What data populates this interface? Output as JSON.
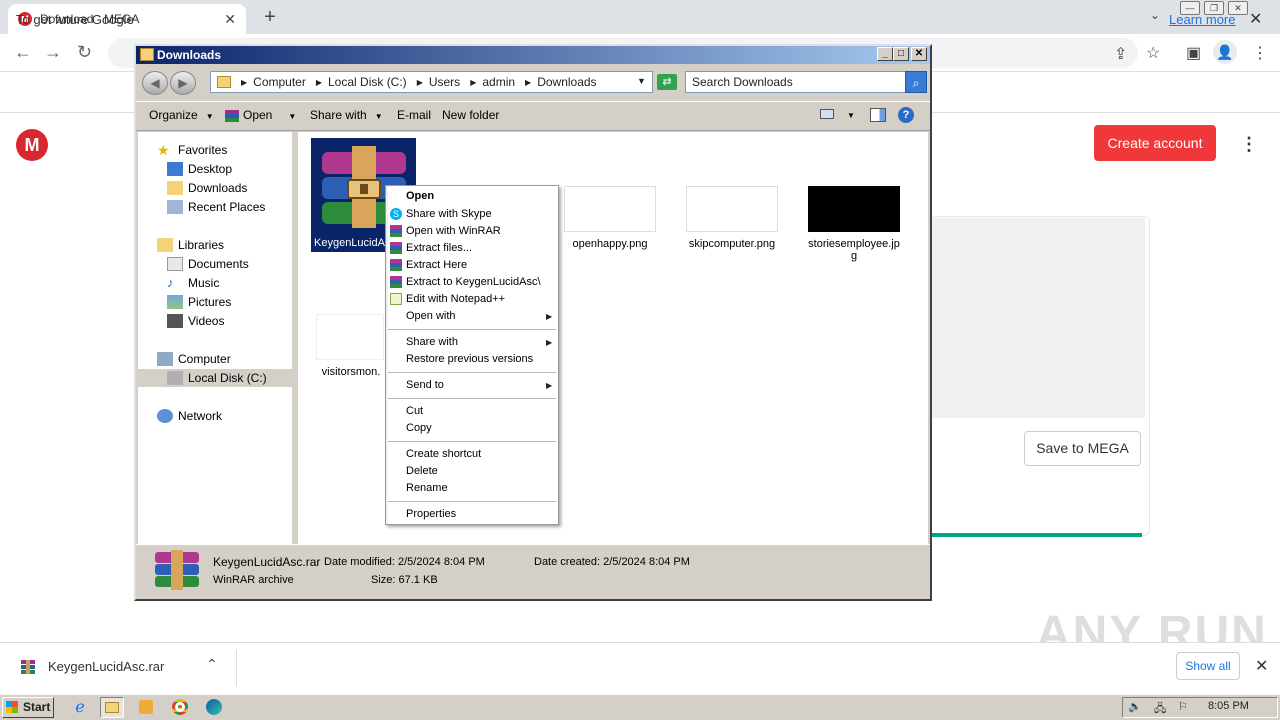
{
  "browser": {
    "tab_title": "Download - MEGA",
    "tab_favicon": "M",
    "new_tab": "+",
    "infobar_text": "To get future Google",
    "infobar_link": "Learn more"
  },
  "mega": {
    "logo": "M",
    "create_account": "Create account",
    "save_to_mega": "Save to MEGA"
  },
  "downloads_bar": {
    "file_name": "KeygenLucidAsc.rar",
    "show_all": "Show all"
  },
  "watermark": "ANY RUN",
  "explorer": {
    "title": "Downloads",
    "breadcrumbs": [
      "Computer",
      "Local Disk (C:)",
      "Users",
      "admin",
      "Downloads"
    ],
    "search_placeholder": "Search Downloads",
    "commands": {
      "organize": "Organize",
      "open": "Open",
      "share_with": "Share with",
      "email": "E-mail",
      "new_folder": "New folder"
    },
    "nav": {
      "favorites": "Favorites",
      "desktop": "Desktop",
      "downloads": "Downloads",
      "recent_places": "Recent Places",
      "libraries": "Libraries",
      "documents": "Documents",
      "music": "Music",
      "pictures": "Pictures",
      "videos": "Videos",
      "computer": "Computer",
      "local_disk": "Local Disk (C:)",
      "network": "Network"
    },
    "files": {
      "selected": "KeygenLucidA",
      "openhappy": "openhappy.png",
      "skipcomputer": "skipcomputer.png",
      "stories_line1": "storiesemployee.jp",
      "stories_line2": "g",
      "visitors": "visitorsmon."
    },
    "status": {
      "name": "KeygenLucidAsc.rar",
      "type": "WinRAR archive",
      "modified": "Date modified: 2/5/2024 8:04 PM",
      "size": "Size: 67.1 KB",
      "created": "Date created: 2/5/2024 8:04 PM"
    }
  },
  "context_menu": {
    "open": "Open",
    "share_skype": "Share with Skype",
    "open_winrar": "Open with WinRAR",
    "extract_files": "Extract files...",
    "extract_here": "Extract Here",
    "extract_to": "Extract to KeygenLucidAsc\\",
    "edit_notepad": "Edit with Notepad++",
    "open_with": "Open with",
    "share_with": "Share with",
    "restore": "Restore previous versions",
    "send_to": "Send to",
    "cut": "Cut",
    "copy": "Copy",
    "create_shortcut": "Create shortcut",
    "delete": "Delete",
    "rename": "Rename",
    "properties": "Properties"
  },
  "taskbar": {
    "start": "Start",
    "clock": "8:05 PM"
  },
  "colors": {
    "mega_red": "#f0373a",
    "selection": "#0a246a",
    "link": "#1a73e8"
  }
}
